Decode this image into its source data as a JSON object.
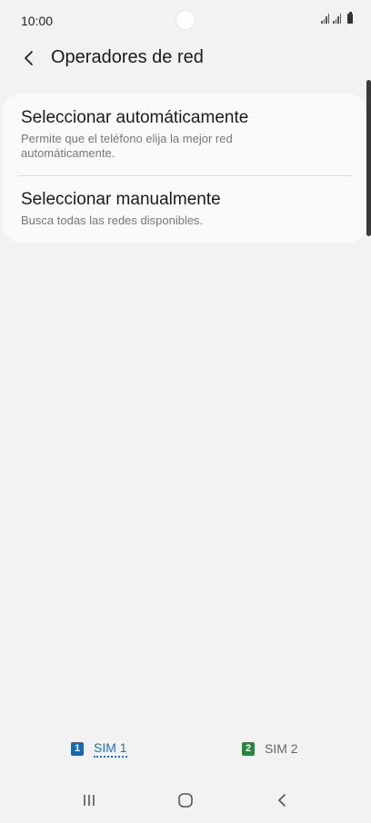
{
  "status_bar": {
    "time": "10:00",
    "icons": [
      "signal-sim1-icon",
      "signal-sim2-icon",
      "battery-icon"
    ]
  },
  "header": {
    "back_icon": "back-chevron-icon",
    "title": "Operadores de red"
  },
  "options": [
    {
      "title": "Seleccionar automáticamente",
      "subtitle_lines": [
        "Permite que el teléfono elija la mejor red",
        "automáticamente."
      ]
    },
    {
      "title": "Seleccionar manualmente",
      "subtitle_lines": [
        "Busca todas las redes disponibles."
      ]
    }
  ],
  "sim_tabs": [
    {
      "badge": "1",
      "label": "SIM 1",
      "selected": true,
      "color": "#1769b0"
    },
    {
      "badge": "2",
      "label": "SIM 2",
      "selected": false,
      "color": "#1f8a3a"
    }
  ],
  "nav_bar": {
    "icons": [
      "recent-apps-icon",
      "home-icon",
      "back-icon"
    ]
  }
}
